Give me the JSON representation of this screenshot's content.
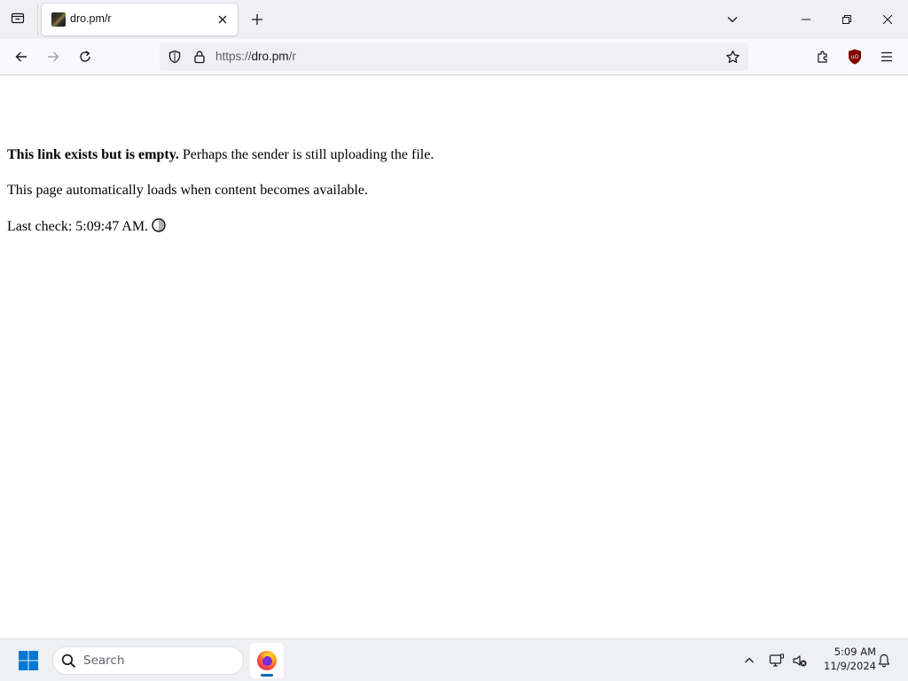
{
  "browser": {
    "tab": {
      "title": "dro.pm/r"
    },
    "url": {
      "scheme": "https://",
      "host": "dro.pm",
      "path": "/r"
    },
    "icons": {
      "tab_list": "tab-list-icon",
      "new_tab": "plus-icon",
      "back": "arrow-left-icon",
      "forward": "arrow-right-icon",
      "reload": "reload-icon",
      "tracking_protection": "shield-icon",
      "security": "lock-icon",
      "bookmark": "star-icon",
      "extensions": "puzzle-icon",
      "ublock": "ublock-icon",
      "menu": "hamburger-icon"
    }
  },
  "page": {
    "line1_bold": "This link exists but is empty.",
    "line1_rest": " Perhaps the sender is still uploading the file.",
    "line2": "This page automatically loads when content becomes available.",
    "line3_label": "Last check:",
    "line3_time": "5:09:47 AM."
  },
  "taskbar": {
    "search_placeholder": "Search",
    "pinned_app": "firefox-icon",
    "clock_time": "5:09 AM",
    "clock_date": "11/9/2024"
  },
  "colors": {
    "tab_strip": "#f0f0f4",
    "nav_bar": "#f9f9fb",
    "url_field": "#f0f0f4",
    "ublock_red": "#800000",
    "windows_blue": "#0078d4",
    "taskbar": "#eef0f3"
  }
}
